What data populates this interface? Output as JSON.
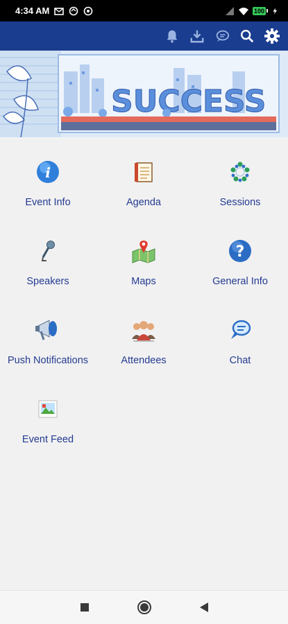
{
  "status_bar": {
    "time": "4:34 AM",
    "battery": "100",
    "icons": [
      "mail-icon",
      "sync-icon",
      "at-icon",
      "signal-icon",
      "wifi-icon",
      "battery-icon",
      "charging-icon"
    ]
  },
  "toolbar": {
    "background": "#1a3d8f",
    "icons": [
      "bell-icon",
      "download-icon",
      "chat-bubble-icon",
      "search-icon",
      "gear-icon"
    ]
  },
  "banner": {
    "text": "SUCCESS"
  },
  "tiles": [
    {
      "label": "Event Info",
      "icon": "info-icon"
    },
    {
      "label": "Agenda",
      "icon": "agenda-notebook-icon"
    },
    {
      "label": "Sessions",
      "icon": "sessions-people-icon"
    },
    {
      "label": "Speakers",
      "icon": "microphone-icon"
    },
    {
      "label": "Maps",
      "icon": "map-pin-icon"
    },
    {
      "label": "General Info",
      "icon": "question-icon"
    },
    {
      "label": "Push Notifications",
      "icon": "megaphone-icon"
    },
    {
      "label": "Attendees",
      "icon": "attendees-group-icon"
    },
    {
      "label": "Chat",
      "icon": "chat-icon"
    },
    {
      "label": "Event Feed",
      "icon": "photo-feed-icon"
    }
  ],
  "nav": {
    "icons": [
      "recents-square-icon",
      "home-circle-icon",
      "back-triangle-icon"
    ]
  }
}
